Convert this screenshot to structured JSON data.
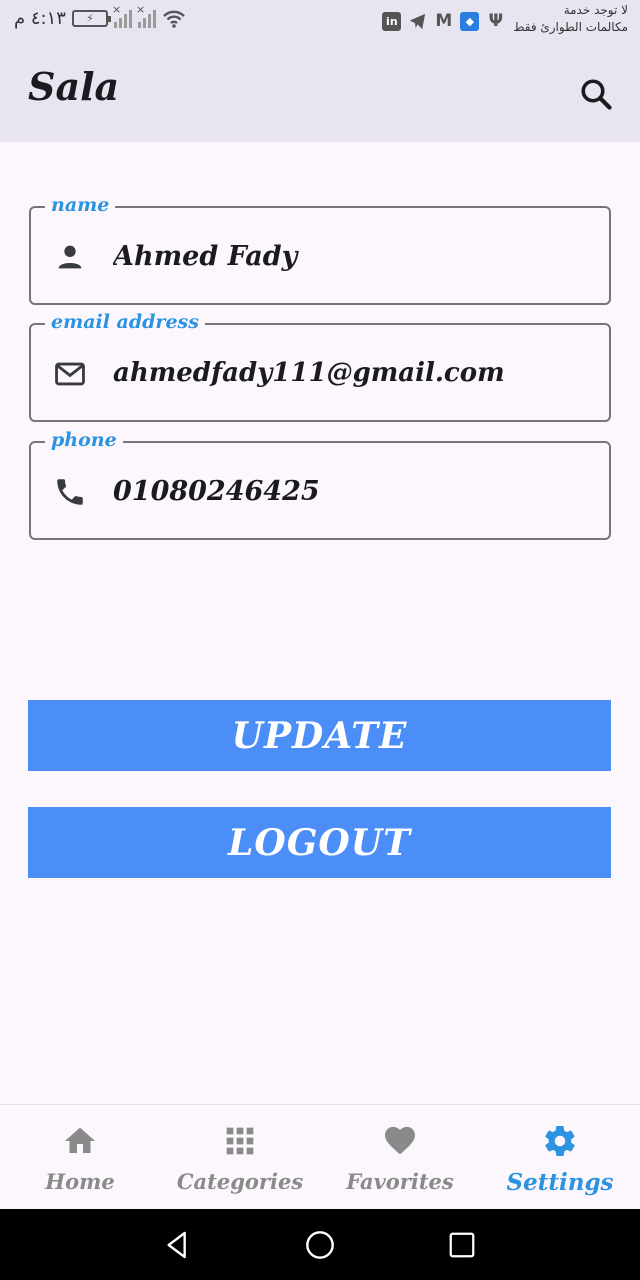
{
  "status_bar": {
    "time": "٤:١٣ م",
    "battery_text": "⚡",
    "carrier_line1": "لا توجد خدمة",
    "carrier_line2": "مكالمات الطوارئ فقط",
    "icons": [
      "linkedin-icon",
      "telegram-icon",
      "gmail-icon",
      "shield-app-icon",
      "usb-icon",
      "wifi-icon",
      "signal-icon"
    ]
  },
  "app_bar": {
    "title": "Sala",
    "search_icon": "search-icon"
  },
  "form": {
    "name": {
      "label": "name",
      "value": "Ahmed Fady",
      "icon": "person-icon"
    },
    "email": {
      "label": "email address",
      "value": "ahmedfady111@gmail.com",
      "icon": "mail-icon"
    },
    "phone": {
      "label": "phone",
      "value": "01080246425",
      "icon": "phone-icon"
    }
  },
  "buttons": {
    "update_label": "UPDATE",
    "logout_label": "LOGOUT",
    "color": "#4b8ef8"
  },
  "bottom_nav": {
    "items": [
      {
        "label": "Home",
        "icon": "home-icon",
        "active": false
      },
      {
        "label": "Categories",
        "icon": "grid-icon",
        "active": false
      },
      {
        "label": "Favorites",
        "icon": "heart-icon",
        "active": false
      },
      {
        "label": "Settings",
        "icon": "gear-icon",
        "active": true
      }
    ],
    "active_color": "#2b93e0",
    "inactive_color": "#8a8a8a"
  },
  "system_nav": {
    "icons": [
      "back-icon",
      "home-circle-icon",
      "recents-icon"
    ]
  }
}
